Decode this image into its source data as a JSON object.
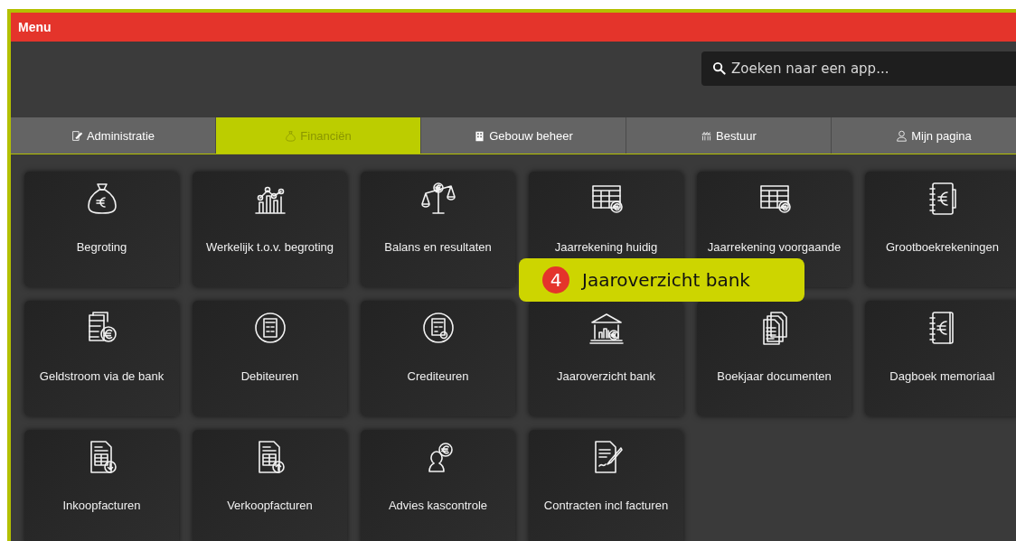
{
  "window": {
    "title": "Menu"
  },
  "search": {
    "placeholder": "Zoeken naar een app..."
  },
  "tabs": [
    {
      "label": "Administratie",
      "selected": false
    },
    {
      "label": "Financiën",
      "selected": true
    },
    {
      "label": "Gebouw beheer",
      "selected": false
    },
    {
      "label": "Bestuur",
      "selected": false
    },
    {
      "label": "Mijn pagina",
      "selected": false
    }
  ],
  "apps": [
    {
      "label": "Begroting"
    },
    {
      "label": "Werkelijk t.o.v. begroting"
    },
    {
      "label": "Balans en resultaten"
    },
    {
      "label": "Jaarrekening huidig"
    },
    {
      "label": "Jaarrekening voorgaande"
    },
    {
      "label": "Grootboekrekeningen"
    },
    {
      "label": "Geldstroom via de bank"
    },
    {
      "label": "Debiteuren"
    },
    {
      "label": "Crediteuren"
    },
    {
      "label": "Jaaroverzicht bank"
    },
    {
      "label": "Boekjaar documenten"
    },
    {
      "label": "Dagboek memoriaal"
    },
    {
      "label": "Inkoopfacturen"
    },
    {
      "label": "Verkoopfacturen"
    },
    {
      "label": "Advies kascontrole"
    },
    {
      "label": "Contracten incl facturen"
    }
  ],
  "callout": {
    "number": "4",
    "text": "Jaaroverzicht bank"
  }
}
